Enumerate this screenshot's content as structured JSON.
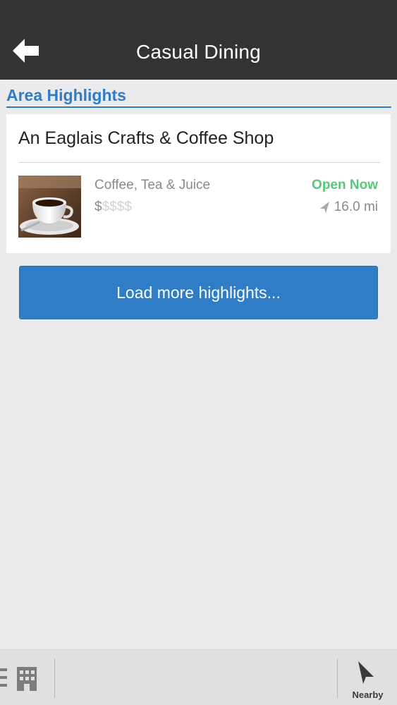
{
  "header": {
    "title": "Casual Dining",
    "back_icon": "back-arrow-icon"
  },
  "section": {
    "title": "Area Highlights"
  },
  "highlights": [
    {
      "name": "An Eaglais Crafts & Coffee Shop",
      "category": "Coffee, Tea & Juice",
      "price_active": "$",
      "price_inactive": "$$$$",
      "price_level": 1,
      "status": "Open Now",
      "distance": "16.0 mi",
      "thumbnail_icon": "coffee-cup-photo"
    }
  ],
  "load_more": {
    "label": "Load more highlights..."
  },
  "tabbar": {
    "list_icon": "list-icon",
    "building_icon": "building-icon",
    "nearby_label": "Nearby",
    "nearby_icon": "location-arrow-icon"
  },
  "colors": {
    "header_bg": "#333333",
    "accent": "#2f7cc7",
    "open_status": "#58c878",
    "background": "#ebebed"
  }
}
